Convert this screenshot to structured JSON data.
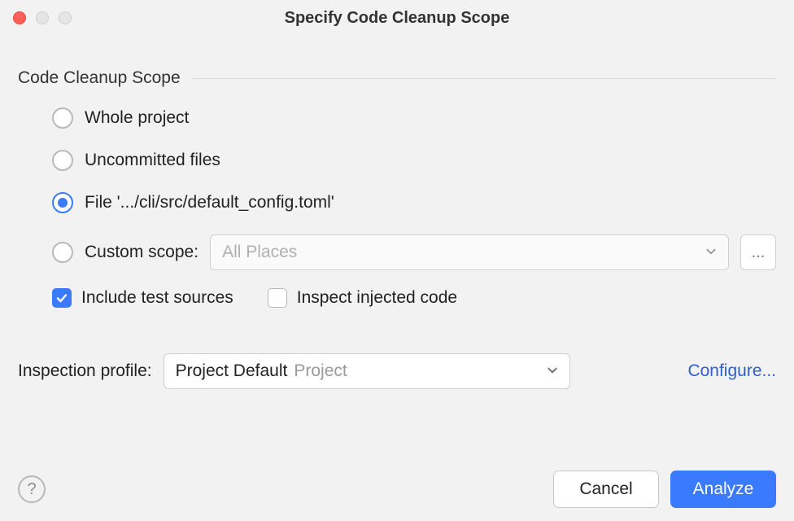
{
  "window": {
    "title": "Specify Code Cleanup Scope"
  },
  "section": {
    "heading": "Code Cleanup Scope"
  },
  "scope": {
    "whole_project": "Whole project",
    "uncommitted_files": "Uncommitted files",
    "file": "File '.../cli/src/default_config.toml'",
    "custom_scope_label": "Custom scope:",
    "custom_scope_value": "All Places",
    "selected": "file"
  },
  "checks": {
    "include_tests": {
      "label": "Include test sources",
      "checked": true
    },
    "inspect_injected": {
      "label": "Inspect injected code",
      "checked": false
    }
  },
  "profile": {
    "label": "Inspection profile:",
    "selected": "Project Default",
    "context": "Project",
    "configure": "Configure..."
  },
  "buttons": {
    "cancel": "Cancel",
    "analyze": "Analyze",
    "more": "...",
    "help": "?"
  }
}
